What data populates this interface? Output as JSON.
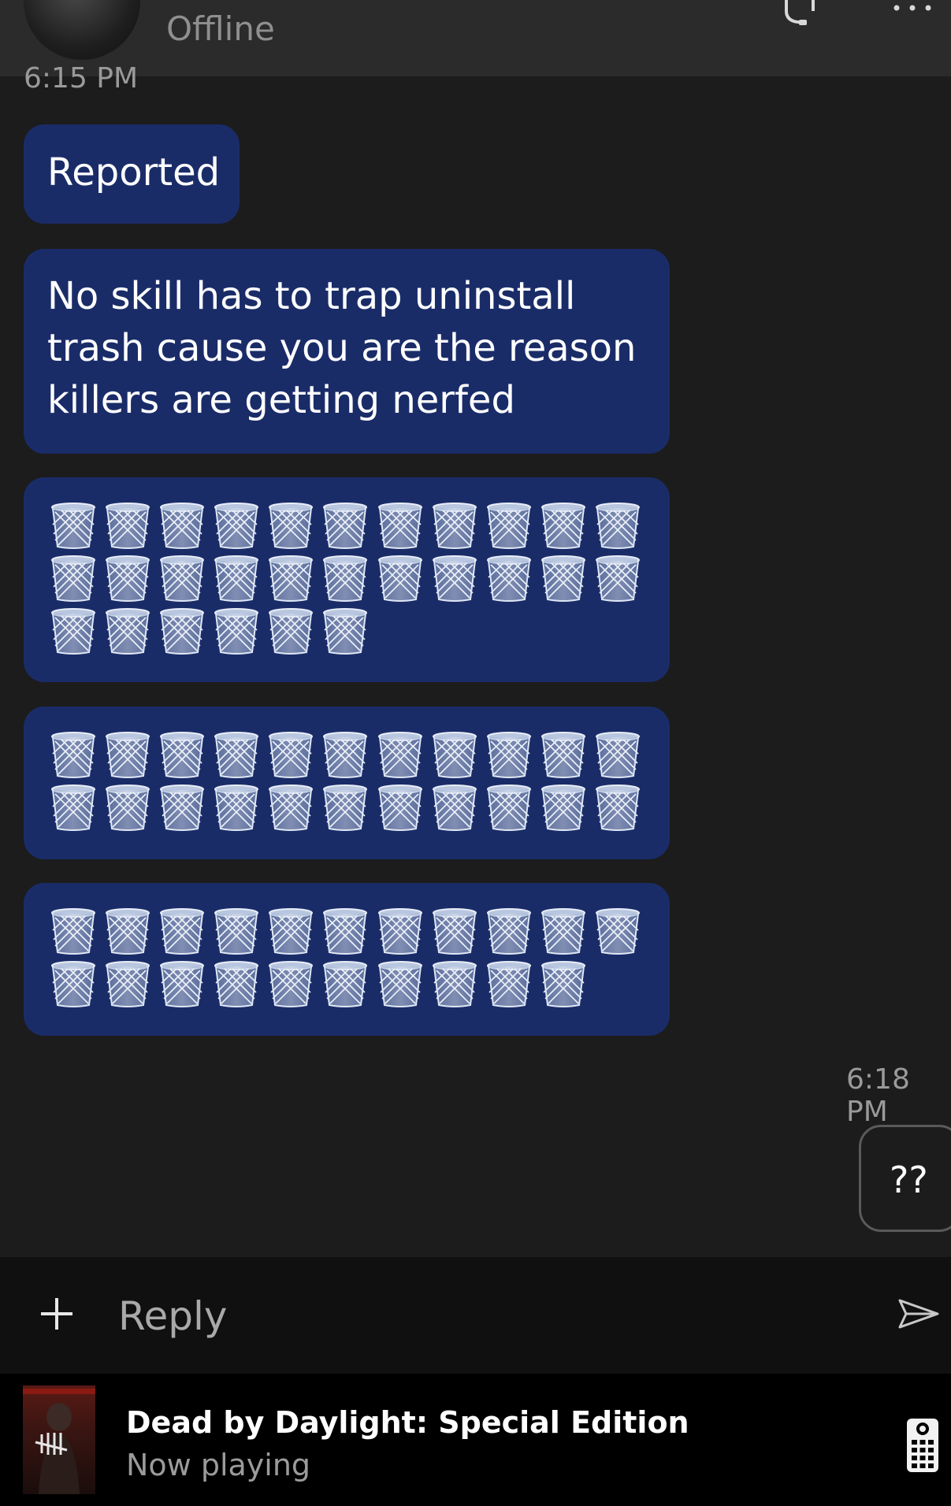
{
  "header": {
    "status": "Offline"
  },
  "conversation": {
    "top_timestamp": "6:15 PM",
    "incoming": [
      {
        "text": "Reported"
      },
      {
        "text": "No skill has to trap uninstall trash cause you are the reason killers are getting nerfed"
      },
      {
        "emoji": "wastebasket",
        "rows": [
          11,
          11,
          6
        ]
      },
      {
        "emoji": "wastebasket",
        "rows": [
          11,
          11
        ]
      },
      {
        "emoji": "wastebasket",
        "rows": [
          11,
          10
        ]
      }
    ],
    "outgoing_timestamp": "6:18 PM",
    "outgoing": {
      "text": "??"
    }
  },
  "composer": {
    "placeholder": "Reply",
    "add_icon": "plus-icon",
    "send_icon": "send-icon"
  },
  "now_playing": {
    "title": "Dead by Daylight: Special Edition",
    "subtitle": "Now playing"
  },
  "colors": {
    "background": "#1c1c1c",
    "incoming_bubble": "#1a2c68",
    "header": "#2b2b2b",
    "muted_text": "#9a9a9a"
  }
}
